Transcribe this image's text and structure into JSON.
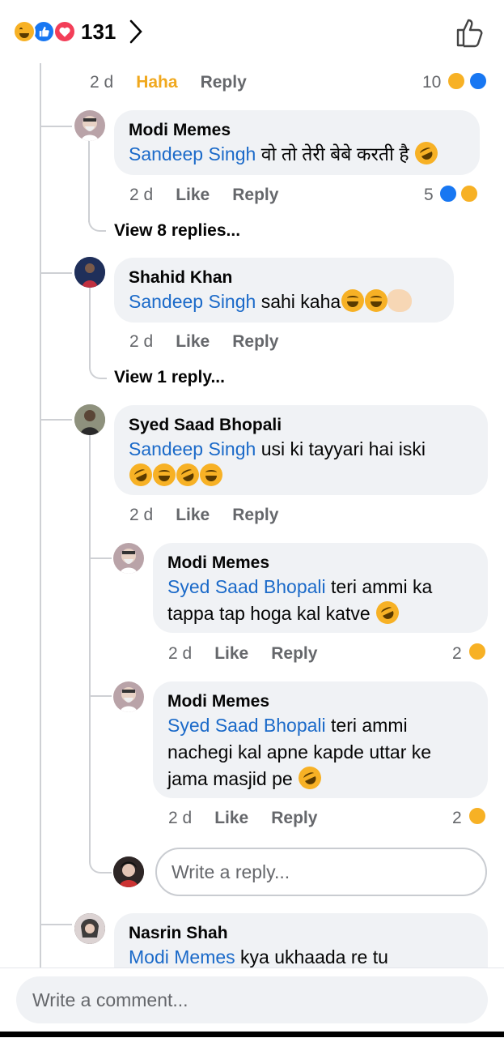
{
  "reactions_summary": {
    "count": "131",
    "icons": [
      "haha-icon",
      "like-icon",
      "love-icon"
    ]
  },
  "top_comment_meta": {
    "time": "2 d",
    "reaction_label": "Haha",
    "reply": "Reply",
    "count": "10"
  },
  "comments": [
    {
      "author": "Modi Memes",
      "mention": "Sandeep Singh",
      "text": " वो तो तेरी बेबे करती है",
      "time": "2 d",
      "like": "Like",
      "reply": "Reply",
      "reaction_count": "5",
      "view_replies": "View 8 replies..."
    },
    {
      "author": "Shahid Khan",
      "mention": "Sandeep Singh",
      "text": " sahi kaha",
      "time": "2 d",
      "like": "Like",
      "reply": "Reply",
      "view_replies": "View 1 reply..."
    },
    {
      "author": "Syed Saad Bhopali",
      "mention": "Sandeep Singh",
      "text": " usi ki tayyari hai iski",
      "time": "2 d",
      "like": "Like",
      "reply": "Reply",
      "replies": [
        {
          "author": "Modi Memes",
          "mention": "Syed Saad Bhopali",
          "text": " teri ammi ka tappa tap hoga kal katve",
          "time": "2 d",
          "like": "Like",
          "reply": "Reply",
          "reaction_count": "2"
        },
        {
          "author": "Modi Memes",
          "mention": "Syed Saad Bhopali",
          "text": " teri ammi nachegi kal apne kapde uttar ke jama masjid pe",
          "time": "2 d",
          "like": "Like",
          "reply": "Reply",
          "reaction_count": "2"
        }
      ],
      "reply_input_placeholder": "Write a reply..."
    },
    {
      "author": "Nasrin Shah",
      "mention": "Modi Memes",
      "text": " kya ukhaada re tu"
    }
  ],
  "comment_input_placeholder": "Write a comment...",
  "colors": {
    "mention": "#1b6ac9",
    "haha": "#f0a81e",
    "bubble": "#f0f2f5",
    "like": "#1877f2",
    "love": "#f33e58"
  }
}
